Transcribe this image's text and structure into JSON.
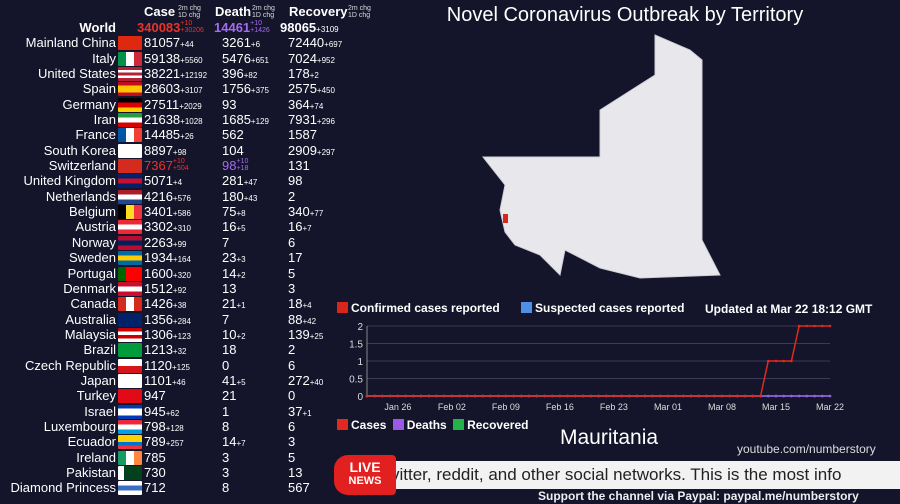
{
  "header": {
    "case": "Case",
    "death": "Death",
    "recovery": "Recovery",
    "chg_top": "2m chg",
    "chg_bottom": "1D chg"
  },
  "world": {
    "name": "World",
    "case": "340083",
    "case_2m": "+10",
    "case_1d": "+30206",
    "death": "14461",
    "death_2m": "+10",
    "death_1d": "+1426",
    "recovery": "98065",
    "recovery_1d": "+3109"
  },
  "rows": [
    {
      "name": "Mainland China",
      "flag": [
        "#de2910"
      ],
      "case": "81057",
      "case_chg": "+44",
      "death": "3261",
      "death_chg": "+6",
      "rec": "72440",
      "rec_chg": "+697"
    },
    {
      "name": "Italy",
      "flag": [
        "#009246",
        "#fff",
        "#ce2b37"
      ],
      "v": 1,
      "case": "59138",
      "case_chg": "+5560",
      "death": "5476",
      "death_chg": "+651",
      "rec": "7024",
      "rec_chg": "+952"
    },
    {
      "name": "United States",
      "flag": [
        "#b22234",
        "#fff",
        "#b22234",
        "#fff",
        "#b22234"
      ],
      "case": "38221",
      "case_chg": "+12192",
      "death": "396",
      "death_chg": "+82",
      "rec": "178",
      "rec_chg": "+2"
    },
    {
      "name": "Spain",
      "flag": [
        "#c60b1e",
        "#ffc400",
        "#ffc400",
        "#c60b1e"
      ],
      "case": "28603",
      "case_chg": "+3107",
      "death": "1756",
      "death_chg": "+375",
      "rec": "2575",
      "rec_chg": "+450"
    },
    {
      "name": "Germany",
      "flag": [
        "#000",
        "#dd0000",
        "#ffce00"
      ],
      "case": "27511",
      "case_chg": "+2029",
      "death": "93",
      "death_chg": "",
      "rec": "364",
      "rec_chg": "+74"
    },
    {
      "name": "Iran",
      "flag": [
        "#239f40",
        "#fff",
        "#da0000"
      ],
      "case": "21638",
      "case_chg": "+1028",
      "death": "1685",
      "death_chg": "+129",
      "rec": "7931",
      "rec_chg": "+296"
    },
    {
      "name": "France",
      "flag": [
        "#0055a4",
        "#fff",
        "#ef4135"
      ],
      "v": 1,
      "case": "14485",
      "case_chg": "+26",
      "death": "562",
      "death_chg": "",
      "rec": "1587",
      "rec_chg": ""
    },
    {
      "name": "South Korea",
      "flag": [
        "#fff"
      ],
      "case": "8897",
      "case_chg": "+98",
      "death": "104",
      "death_chg": "",
      "rec": "2909",
      "rec_chg": "+297"
    },
    {
      "name": "Switzerland",
      "flag": [
        "#d52b1e"
      ],
      "highlight": true,
      "case": "7367",
      "case_2m": "+10",
      "case_1d": "+504",
      "death": "98",
      "death_2m": "+10",
      "death_1d": "+18",
      "rec": "131",
      "rec_chg": ""
    },
    {
      "name": "United Kingdom",
      "flag": [
        "#012169",
        "#c8102e",
        "#012169"
      ],
      "case": "5071",
      "case_chg": "+4",
      "death": "281",
      "death_chg": "+47",
      "rec": "98",
      "rec_chg": ""
    },
    {
      "name": "Netherlands",
      "flag": [
        "#ae1c28",
        "#fff",
        "#21468b"
      ],
      "case": "4216",
      "case_chg": "+576",
      "death": "180",
      "death_chg": "+43",
      "rec": "2",
      "rec_chg": ""
    },
    {
      "name": "Belgium",
      "flag": [
        "#000",
        "#fdda24",
        "#ef3340"
      ],
      "v": 1,
      "case": "3401",
      "case_chg": "+586",
      "death": "75",
      "death_chg": "+8",
      "rec": "340",
      "rec_chg": "+77"
    },
    {
      "name": "Austria",
      "flag": [
        "#ed2939",
        "#fff",
        "#ed2939"
      ],
      "case": "3302",
      "case_chg": "+310",
      "death": "16",
      "death_chg": "+5",
      "rec": "16",
      "rec_chg": "+7"
    },
    {
      "name": "Norway",
      "flag": [
        "#ba0c2f",
        "#00205b",
        "#ba0c2f"
      ],
      "case": "2263",
      "case_chg": "+99",
      "death": "7",
      "death_chg": "",
      "rec": "6",
      "rec_chg": ""
    },
    {
      "name": "Sweden",
      "flag": [
        "#006aa7",
        "#fecc00",
        "#006aa7"
      ],
      "case": "1934",
      "case_chg": "+164",
      "death": "23",
      "death_chg": "+3",
      "rec": "17",
      "rec_chg": ""
    },
    {
      "name": "Portugal",
      "flag": [
        "#006600",
        "#ff0000",
        "#ff0000"
      ],
      "v": 1,
      "case": "1600",
      "case_chg": "+320",
      "death": "14",
      "death_chg": "+2",
      "rec": "5",
      "rec_chg": ""
    },
    {
      "name": "Denmark",
      "flag": [
        "#c8102e",
        "#fff",
        "#c8102e"
      ],
      "case": "1512",
      "case_chg": "+92",
      "death": "13",
      "death_chg": "",
      "rec": "3",
      "rec_chg": ""
    },
    {
      "name": "Canada",
      "flag": [
        "#d52b1e",
        "#fff",
        "#d52b1e"
      ],
      "v": 1,
      "case": "1426",
      "case_chg": "+38",
      "death": "21",
      "death_chg": "+1",
      "rec": "18",
      "rec_chg": "+4"
    },
    {
      "name": "Australia",
      "flag": [
        "#012169"
      ],
      "case": "1356",
      "case_chg": "+284",
      "death": "7",
      "death_chg": "",
      "rec": "88",
      "rec_chg": "+42"
    },
    {
      "name": "Malaysia",
      "flag": [
        "#cc0001",
        "#fff",
        "#cc0001",
        "#fff"
      ],
      "case": "1306",
      "case_chg": "+123",
      "death": "10",
      "death_chg": "+2",
      "rec": "139",
      "rec_chg": "+25"
    },
    {
      "name": "Brazil",
      "flag": [
        "#009c3b"
      ],
      "case": "1213",
      "case_chg": "+32",
      "death": "18",
      "death_chg": "",
      "rec": "2",
      "rec_chg": ""
    },
    {
      "name": "Czech Republic",
      "flag": [
        "#fff",
        "#d7141a"
      ],
      "case": "1120",
      "case_chg": "+125",
      "death": "0",
      "death_chg": "",
      "rec": "6",
      "rec_chg": ""
    },
    {
      "name": "Japan",
      "flag": [
        "#fff"
      ],
      "case": "1101",
      "case_chg": "+46",
      "death": "41",
      "death_chg": "+5",
      "rec": "272",
      "rec_chg": "+40"
    },
    {
      "name": "Turkey",
      "flag": [
        "#e30a17"
      ],
      "case": "947",
      "case_chg": "",
      "death": "21",
      "death_chg": "",
      "rec": "0",
      "rec_chg": ""
    },
    {
      "name": "Israel",
      "flag": [
        "#0038b8",
        "#fff",
        "#fff",
        "#0038b8"
      ],
      "case": "945",
      "case_chg": "+62",
      "death": "1",
      "death_chg": "",
      "rec": "37",
      "rec_chg": "+1"
    },
    {
      "name": "Luxembourg",
      "flag": [
        "#ed2939",
        "#fff",
        "#00a1de"
      ],
      "case": "798",
      "case_chg": "+128",
      "death": "8",
      "death_chg": "",
      "rec": "6",
      "rec_chg": ""
    },
    {
      "name": "Ecuador",
      "flag": [
        "#ffd100",
        "#ffd100",
        "#0072ce",
        "#ef3340"
      ],
      "case": "789",
      "case_chg": "+257",
      "death": "14",
      "death_chg": "+7",
      "rec": "3",
      "rec_chg": ""
    },
    {
      "name": "Ireland",
      "flag": [
        "#169b62",
        "#fff",
        "#ff883e"
      ],
      "v": 1,
      "case": "785",
      "case_chg": "",
      "death": "3",
      "death_chg": "",
      "rec": "5",
      "rec_chg": ""
    },
    {
      "name": "Pakistan",
      "flag": [
        "#fff",
        "#01411c",
        "#01411c",
        "#01411c"
      ],
      "v": 1,
      "case": "730",
      "case_chg": "",
      "death": "3",
      "death_chg": "",
      "rec": "13",
      "rec_chg": ""
    },
    {
      "name": "Diamond Princess",
      "flag": [
        "#fff",
        "#3a6ec2",
        "#fff"
      ],
      "case": "712",
      "case_chg": "",
      "death": "8",
      "death_chg": "",
      "rec": "567",
      "rec_chg": ""
    }
  ],
  "title": "Novel Coronavirus Outbreak by Territory",
  "map_legend": {
    "confirmed": "Confirmed cases reported",
    "suspected": "Suspected cases reported",
    "updated": "Updated at Mar 22 18:12 GMT",
    "confirmed_color": "#d8261c",
    "suspected_color": "#4f8fe6"
  },
  "chart_data": {
    "type": "line",
    "x_start": "Jan 22",
    "x_end": "Mar 22",
    "x_ticks": [
      "Jan 26",
      "Feb 02",
      "Feb 09",
      "Feb 16",
      "Feb 23",
      "Mar 01",
      "Mar 08",
      "Mar 15",
      "Mar 22"
    ],
    "y_ticks": [
      "0",
      "0.5",
      "1",
      "1.5",
      "2"
    ],
    "ylim": [
      0,
      2
    ],
    "grid": true,
    "series": [
      {
        "name": "Cases",
        "color": "#e02a1e",
        "steps": [
          [
            "Jan 22",
            0
          ],
          [
            "Mar 14",
            1
          ],
          [
            "Mar 18",
            2
          ]
        ]
      },
      {
        "name": "Deaths",
        "color": "#9b59e8",
        "steps": [
          [
            "Jan 22",
            0
          ]
        ]
      },
      {
        "name": "Recovered",
        "color": "#22b34a",
        "steps": [
          [
            "Jan 22",
            0
          ]
        ]
      }
    ],
    "legend": "bottom-left"
  },
  "country": "Mauritania",
  "youtube": "youtube.com/numberstory",
  "live": {
    "line1": "LIVE",
    "line2": "NEWS"
  },
  "ticker": "vitter, reddit, and other social networks. This is the most info",
  "support": "Support the channel via Paypal: paypal.me/numberstory",
  "watermark": "Diamond Princess"
}
